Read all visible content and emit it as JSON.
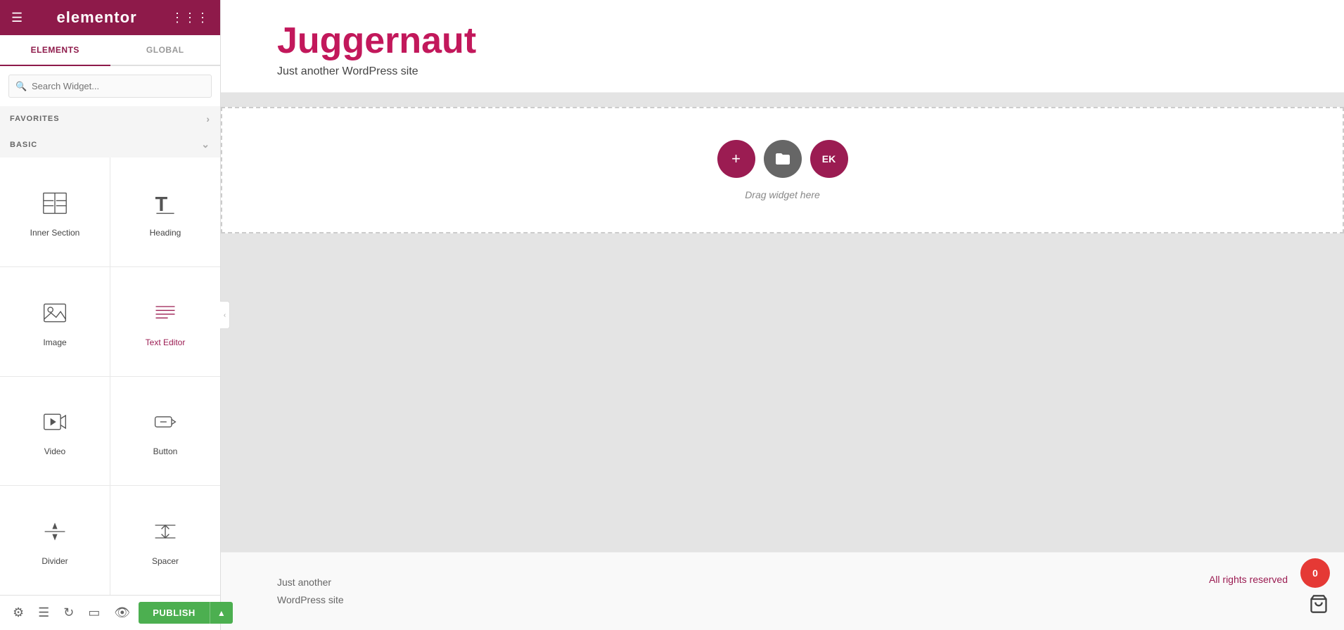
{
  "app": {
    "title": "elementor"
  },
  "sidebar": {
    "tabs": [
      {
        "id": "elements",
        "label": "ELEMENTS",
        "active": true
      },
      {
        "id": "global",
        "label": "GLOBAL",
        "active": false
      }
    ],
    "search": {
      "placeholder": "Search Widget..."
    },
    "sections": {
      "favorites": {
        "label": "FAVORITES",
        "expanded": false
      },
      "basic": {
        "label": "BASIC",
        "expanded": true
      }
    },
    "widgets": [
      {
        "id": "inner-section",
        "label": "Inner Section",
        "icon": "inner-section-icon",
        "active": false
      },
      {
        "id": "heading",
        "label": "Heading",
        "icon": "heading-icon",
        "active": false
      },
      {
        "id": "image",
        "label": "Image",
        "icon": "image-icon",
        "active": false
      },
      {
        "id": "text-editor",
        "label": "Text Editor",
        "icon": "text-editor-icon",
        "active": true
      },
      {
        "id": "video",
        "label": "Video",
        "icon": "video-icon",
        "active": false
      },
      {
        "id": "button",
        "label": "Button",
        "icon": "button-icon",
        "active": false
      },
      {
        "id": "divider",
        "label": "Divider",
        "icon": "divider-icon",
        "active": false
      },
      {
        "id": "spacer",
        "label": "Spacer",
        "icon": "spacer-icon",
        "active": false
      }
    ],
    "footer": {
      "settings_label": "Settings",
      "layers_label": "Layers",
      "history_label": "History",
      "navigator_label": "Navigator",
      "eye_label": "Preview",
      "publish_label": "PUBLISH"
    }
  },
  "canvas": {
    "site_title": "Juggernaut",
    "site_tagline": "Just another WordPress site",
    "drop_zone": {
      "drag_text": "Drag widget here",
      "add_btn_title": "Add",
      "folder_btn_title": "Templates",
      "ek_btn_label": "EK"
    },
    "footer": {
      "left_line1": "Just another",
      "left_line2": "WordPress site",
      "right": "All rights reserved"
    }
  },
  "floating": {
    "cart_count": "0"
  }
}
